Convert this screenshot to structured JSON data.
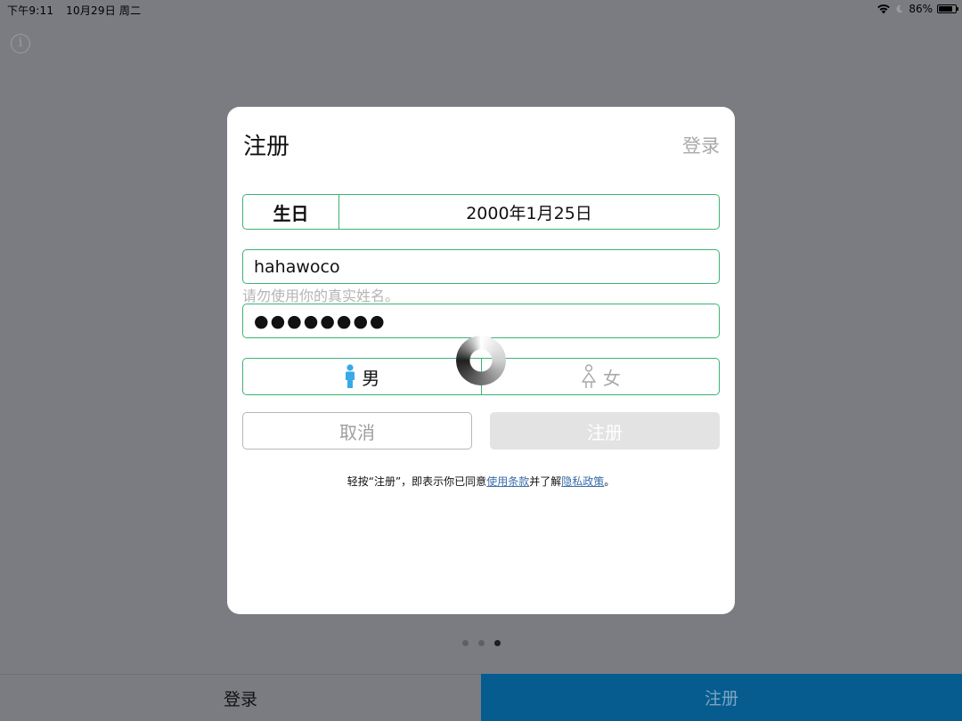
{
  "status_bar": {
    "time": "下午9:11",
    "date": "10月29日 周二",
    "battery": "86%",
    "battery_level": 0.86
  },
  "info_icon_glyph": "i",
  "modal": {
    "title": "注册",
    "login_link": "登录",
    "birthday_label": "生日",
    "birthday_value": "2000年1月25日",
    "name_value": "hahawoco",
    "name_hint": "请勿使用你的真实姓名。",
    "password_mask": "●●●●●●●●",
    "gender_male": "男",
    "gender_female": "女",
    "selected_gender": "male",
    "cancel_button": "取消",
    "submit_button": "注册",
    "terms": {
      "prefix": "轻按“注册”，即表示你已同意",
      "terms_link": "使用条款",
      "middle": "并了解",
      "privacy_link": "隐私政策",
      "suffix": "。"
    }
  },
  "pager": {
    "count": 3,
    "active": 3
  },
  "bottom_tabs": {
    "login": "登录",
    "register": "注册",
    "active": "register"
  },
  "colors": {
    "accent_green": "#3bb371",
    "active_tab": "#065c8f",
    "male_icon": "#39a9e8",
    "link": "#3a6ea8"
  }
}
